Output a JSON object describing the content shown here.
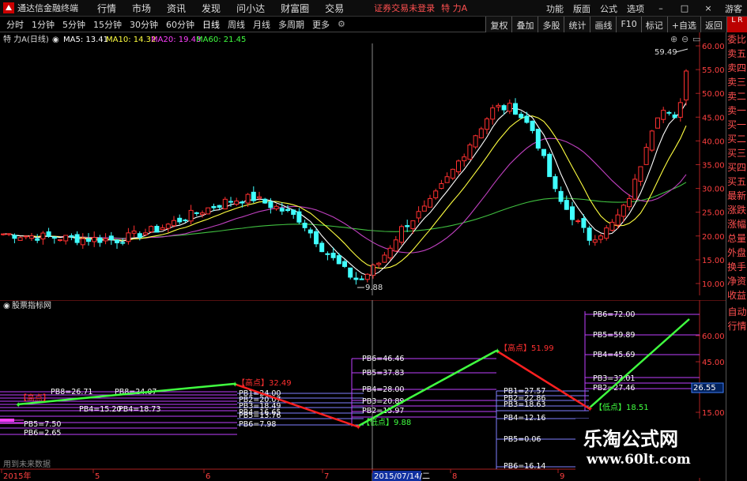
{
  "menubar": {
    "app_title": "通达信金融终端",
    "menus": [
      "行情",
      "市场",
      "资讯",
      "发现",
      "问小达",
      "财富圈",
      "交易"
    ],
    "warning": "证券交易未登录",
    "stock": "特 力A",
    "right_items": [
      "功能",
      "版面",
      "公式",
      "选项"
    ],
    "user": "游客"
  },
  "periodbar": {
    "items": [
      "分时",
      "1分钟",
      "5分钟",
      "15分钟",
      "30分钟",
      "60分钟",
      "日线",
      "周线",
      "月线",
      "多周期",
      "更多"
    ],
    "active": "日线"
  },
  "toolbar": {
    "items": [
      "复权",
      "叠加",
      "多股",
      "统计",
      "画线",
      "F10",
      "标记",
      "+自选",
      "返回"
    ],
    "red_badge": "L R"
  },
  "main": {
    "title": "特 力A(日线)",
    "ma": [
      {
        "label": "MA5: 13.41",
        "color": "#ffffff"
      },
      {
        "label": "MA10: 14.32",
        "color": "#ffff40"
      },
      {
        "label": "MA20: 19.43",
        "color": "#ff40ff"
      },
      {
        "label": "MA60: 21.45",
        "color": "#40ff40"
      }
    ],
    "high_label": "59.49",
    "low_label": "9.88",
    "y_ticks": [
      "60.00",
      "55.00",
      "50.00",
      "45.00",
      "40.00",
      "35.00",
      "30.00",
      "25.00",
      "20.00",
      "15.00",
      "10.00"
    ]
  },
  "indicator": {
    "title": "股票指标网",
    "y_ticks": [
      "60.00",
      "45.00",
      "26.55",
      "15.00"
    ],
    "current_value": "26.55",
    "x_labels": [
      "2015年",
      "5",
      "6",
      "7",
      "2015/07/14/二",
      "8",
      "9"
    ],
    "footer": "用到未来数据",
    "annotations": [
      {
        "text": "【高点】32.49",
        "color": "#ff3030"
      },
      {
        "text": "【低点】9.88",
        "color": "#40ff40"
      },
      {
        "text": "【高点】51.99",
        "color": "#ff3030"
      },
      {
        "text": "【低点】18.51",
        "color": "#40ff40"
      },
      {
        "text": "【高点】",
        "color": "#ff3030"
      }
    ],
    "pb_groups": [
      {
        "labels": [
          "PB5=7.50",
          "PB6=2.65"
        ]
      },
      {
        "labels": [
          "PB8=26.71",
          "PB8=24.07",
          "PB4=15.20",
          "PB4=18.73"
        ]
      },
      {
        "labels": [
          "PB1=24.00",
          "PB2=20.07",
          "PB3=18.49",
          "PB4=16.65",
          "PB5=13.76",
          "PB6=7.98"
        ]
      },
      {
        "labels": [
          "PB6=46.46",
          "PB5=37.83",
          "PB4=28.00",
          "PB3=20.89",
          "PB2=15.97"
        ]
      },
      {
        "labels": [
          "PB1=27.57",
          "PB2=22.86",
          "PB3=18.63",
          "PB4=12.16",
          "PB5=0.06",
          "PB6=16.14"
        ]
      },
      {
        "labels": [
          "PB6=72.00",
          "PB5=59.89",
          "PB4=45.69",
          "PB3=32.01",
          "PB2=27.46"
        ]
      }
    ]
  },
  "sidepanel": {
    "items": [
      "委比",
      "卖五",
      "卖四",
      "卖三",
      "卖二",
      "卖一",
      "买一",
      "买二",
      "买三",
      "买四",
      "买五",
      "最新",
      "涨跌",
      "涨幅",
      "总量",
      "外盘",
      "换手",
      "净资",
      "收益"
    ],
    "bottom_items": [
      "自动",
      "行情"
    ]
  },
  "watermark": {
    "cn": "乐淘公式网",
    "url": "www.60lt.com"
  },
  "colors": {
    "up": "#ff3030",
    "down": "#40ffff",
    "ma5": "#ffffff",
    "ma10": "#ffff40",
    "ma20": "#c040c0",
    "ma60": "#40c040",
    "axis": "#ff3030"
  }
}
